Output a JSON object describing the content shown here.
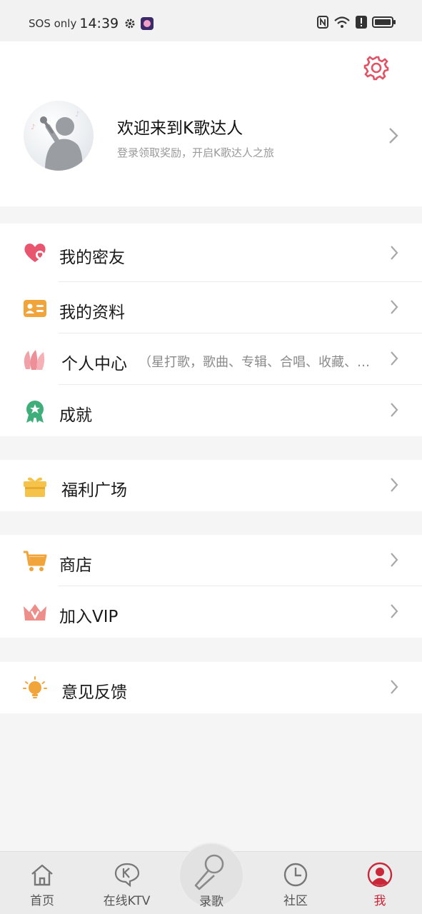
{
  "status_bar": {
    "carrier": "SOS only",
    "time": "14:39"
  },
  "profile": {
    "title": "欢迎来到K歌达人",
    "subtitle": "登录领取奖励，开启K歌达人之旅"
  },
  "menu": {
    "friends": "我的密友",
    "profile_info": "我的资料",
    "personal_center": "个人中心",
    "personal_center_hint": "（星打歌，歌曲、专辑、合唱、收藏、…",
    "achievements": "成就",
    "welfare": "福利广场",
    "shop": "商店",
    "vip": "加入VIP",
    "feedback": "意见反馈"
  },
  "bottom_nav": {
    "home": "首页",
    "ktv": "在线KTV",
    "record": "录歌",
    "community": "社区",
    "me": "我"
  },
  "colors": {
    "accent_red": "#c8283a",
    "pink": "#e8556e",
    "orange": "#f1a43a",
    "green": "#3fae7a",
    "background": "#f5f5f5"
  }
}
